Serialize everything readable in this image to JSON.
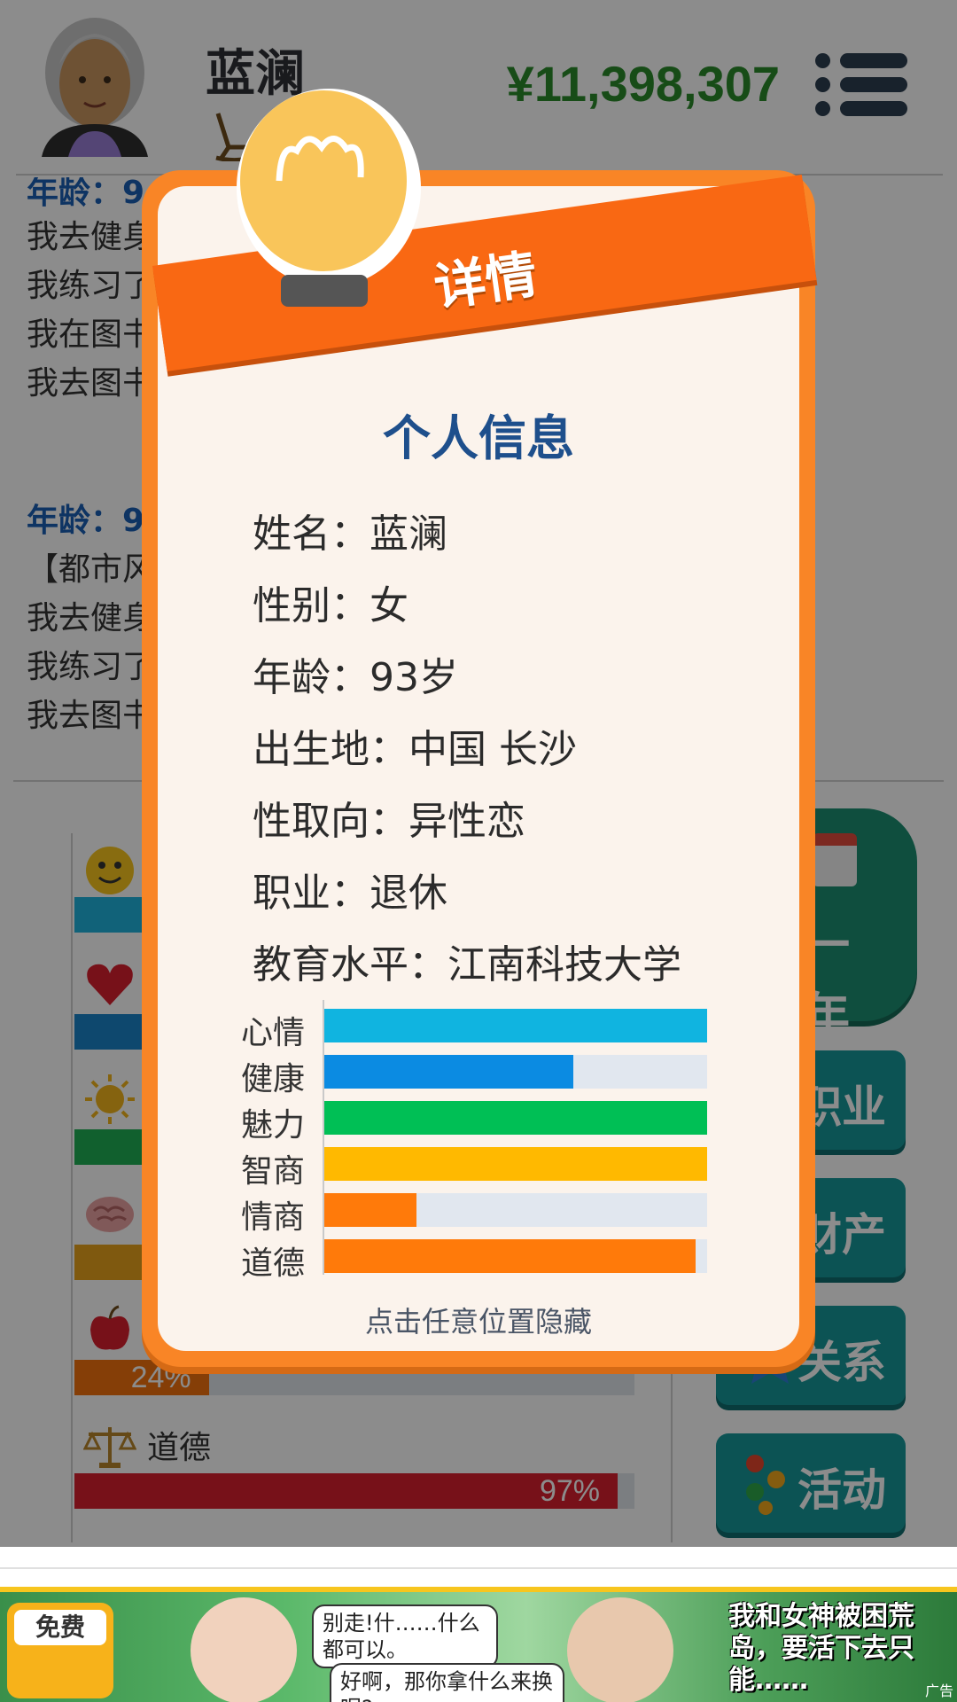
{
  "header": {
    "name": "蓝澜",
    "money": "¥11,398,307"
  },
  "log": {
    "entries": [
      {
        "text": "年龄：9",
        "style": "age"
      },
      {
        "text": "我去健身",
        "style": "normal"
      },
      {
        "text": "我练习了",
        "style": "normal"
      },
      {
        "text": "我在图书",
        "style": "normal"
      },
      {
        "text": "我去图书",
        "style": "normal"
      },
      {
        "text": "年龄：9",
        "style": "age"
      },
      {
        "text": "【都市风",
        "style": "normal"
      },
      {
        "text": "我去健身",
        "style": "normal"
      },
      {
        "text": "我练习了",
        "style": "normal"
      },
      {
        "text": "我去图书",
        "style": "normal"
      }
    ]
  },
  "stats": [
    {
      "label": "心情",
      "icon": "smiley-icon",
      "value": 100,
      "color": "#1fb3dd"
    },
    {
      "label": "健康",
      "icon": "heart-icon",
      "value": 65,
      "color": "#1a84c9"
    },
    {
      "label": "魅力",
      "icon": "sun-icon",
      "value": 100,
      "color": "#1fb055"
    },
    {
      "label": "智商",
      "icon": "brain-icon",
      "value": 100,
      "color": "#e7a31c"
    },
    {
      "label": "情商",
      "icon": "apple-icon",
      "value": 24,
      "pct_text": "24%",
      "color": "#f2720d"
    },
    {
      "label": "道德",
      "icon": "scales-icon",
      "value": 97,
      "pct_text": "97%",
      "color": "#d91f2e"
    }
  ],
  "side_buttons": {
    "year": "一年",
    "career": "职业",
    "assets": "财产",
    "relations": "关系",
    "activities": "活动"
  },
  "modal": {
    "ribbon_title": "详情",
    "heading": "个人信息",
    "info": [
      {
        "label": "姓名：",
        "value": "蓝澜"
      },
      {
        "label": "性别：",
        "value": "女"
      },
      {
        "label": "年龄：",
        "value": "93岁"
      },
      {
        "label": "出生地：",
        "value": "中国 长沙"
      },
      {
        "label": "性取向：",
        "value": "异性恋"
      },
      {
        "label": "职业：",
        "value": "退休"
      },
      {
        "label": "教育水平：",
        "value": "江南科技大学"
      }
    ],
    "bars": [
      {
        "label": "心情",
        "value": 100,
        "color": "#10b4e0"
      },
      {
        "label": "健康",
        "value": 65,
        "color": "#0b8be2"
      },
      {
        "label": "魅力",
        "value": 100,
        "color": "#00bf55"
      },
      {
        "label": "智商",
        "value": 100,
        "color": "#ffb900"
      },
      {
        "label": "情商",
        "value": 24,
        "color": "#ff7a0a"
      },
      {
        "label": "道德",
        "value": 97,
        "color": "#ff7a0a"
      }
    ],
    "hint": "点击任意位置隐藏"
  },
  "ad": {
    "free_label": "免费",
    "bubble_1": "别走!什……什么都可以。",
    "bubble_2": "好啊，那你拿什么来换呢?",
    "headline": "我和女神被困荒岛，要活下去只能……",
    "tag": "广告"
  }
}
